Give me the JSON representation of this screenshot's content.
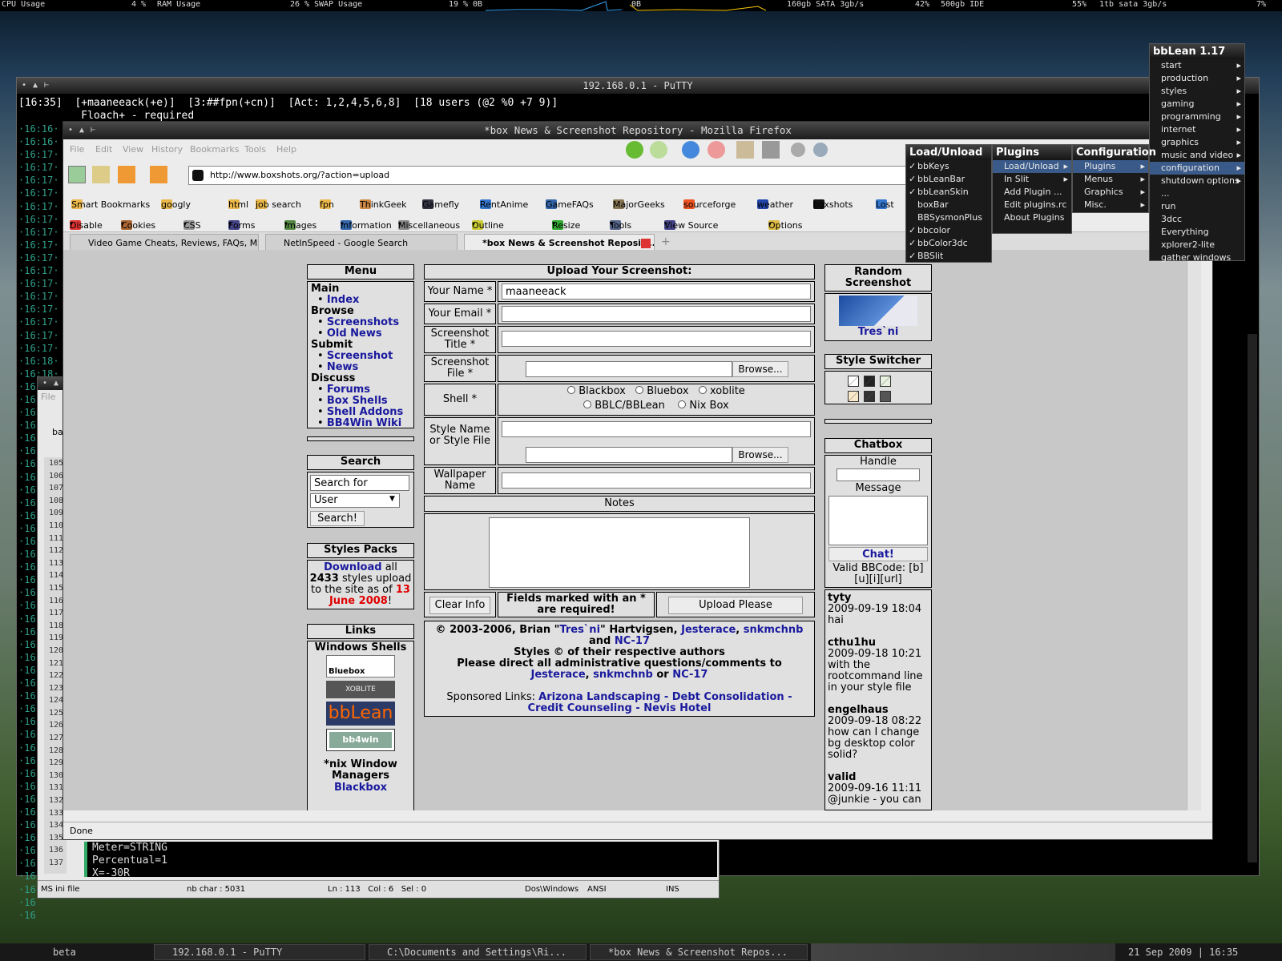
{
  "sysbar": {
    "cpu_label": "CPU Usage",
    "cpu_val": "4 %",
    "ram_label": "RAM Usage",
    "ram_val": "26 %",
    "swap_label": "SWAP Usage",
    "swap_val": "19 %",
    "net1": "0B",
    "net2": "0B",
    "disk1": "160gb SATA 3gb/s",
    "disk1_val": "42%",
    "disk2": "500gb IDE",
    "disk2_val": "55%",
    "disk3": "1tb sata 3gb/s",
    "disk3_val": "7%"
  },
  "putty": {
    "title": "192.168.0.1 - PuTTY",
    "status_time": "16:35",
    "status_nick": "+maaneeack(+e)",
    "status_chan": "3:##fpn(+cn)",
    "status_act": "Act: 1,2,4,5,6,8",
    "status_users": "18 users (@2 %0 +7 9)",
    "line1": "Floach+ - required",
    "times": [
      "·16:16·",
      "·16:16·",
      "·16:17·",
      "·16:17·",
      "·16:17·",
      "·16:17·",
      "·16:17·",
      "·16:17·",
      "·16:17·",
      "·16:17·",
      "·16:17·",
      "·16:17·",
      "·16:17·",
      "·16:17·",
      "·16:17·",
      "·16:17·",
      "·16:17·",
      "·16:17·",
      "·16:18·",
      "·16:18·",
      "·16:18·",
      "·16:18·",
      "·16:18·",
      "·16:16",
      "·16",
      "·16",
      "·16",
      "·16",
      "·16",
      "·16",
      "·16",
      "·16",
      "·16",
      "·16",
      "·16",
      "·16",
      "·16",
      "·16",
      "·16",
      "·16",
      "·16",
      "·16",
      "·16",
      "·16",
      "·16",
      "·16",
      "·16",
      "·16",
      "·16",
      "·16",
      "·16",
      "·16",
      "·16",
      "·16",
      "·16",
      "·16",
      "·16",
      "·16",
      "·16",
      "·16",
      "·16",
      "·16"
    ]
  },
  "editor": {
    "menu_file": "File",
    "tab_label": "ba",
    "lines": [
      "105",
      "106",
      "107",
      "108",
      "109",
      "110",
      "111",
      "112",
      "113",
      "114",
      "115",
      "116",
      "117",
      "118",
      "119",
      "120",
      "121",
      "122",
      "123",
      "124",
      "125",
      "126",
      "127",
      "128",
      "129",
      "130",
      "131",
      "132",
      "133",
      "134",
      "135",
      "136",
      "137"
    ],
    "code": [
      "Meter=STRING",
      "Percentual=1",
      "X=-30R"
    ],
    "status": {
      "type": "MS ini file",
      "chars": "nb char : 5031",
      "pos": "Ln : 113   Col : 6   Sel : 0",
      "eol": "Dos\\Windows",
      "enc": "ANSI",
      "mode": "INS"
    }
  },
  "firefox": {
    "title": "*box News & Screenshot Repository - Mozilla Firefox",
    "menu": [
      "File",
      "Edit",
      "View",
      "History",
      "Bookmarks",
      "Tools",
      "Help"
    ],
    "url": "http://www.boxshots.org/?action=upload",
    "bookmarks": [
      "Smart Bookmarks",
      "googly",
      "html",
      "job search",
      "fpn",
      "ThinkGeek",
      "Gamefly",
      "RentAnime",
      "GameFAQs",
      "MajorGeeks",
      "sourceforge",
      "weather",
      "boxshots",
      "Lost"
    ],
    "webdev": [
      "Disable",
      "Cookies",
      "CSS",
      "Forms",
      "Images",
      "Information",
      "Miscellaneous",
      "Outline",
      "Resize",
      "Tools",
      "View Source",
      "Options"
    ],
    "tabs": [
      "Video Game Cheats, Reviews, FAQs, M...",
      "NetInSpeed - Google Search",
      "*box News & Screenshot Reposit..."
    ],
    "status": "Done"
  },
  "page": {
    "menu": {
      "title": "Menu",
      "main": "Main",
      "index": "Index",
      "browse": "Browse",
      "screenshots": "Screenshots",
      "oldnews": "Old News",
      "submit": "Submit",
      "screenshot": "Screenshot",
      "news": "News",
      "discuss": "Discuss",
      "forums": "Forums",
      "boxshells": "Box Shells",
      "shelladdons": "Shell Addons",
      "wiki": "BB4Win Wiki"
    },
    "search": {
      "title": "Search",
      "placeholder": "Search for",
      "select": "User",
      "button": "Search!"
    },
    "styles": {
      "title": "Styles Packs",
      "download": "Download",
      "t1": " all ",
      "count": "2433",
      "t2": " styles upload to the site as of ",
      "date": "13 June 2008",
      "t3": "!"
    },
    "links": {
      "title": "Links",
      "shells": "Windows Shells",
      "bluebox": "Bluebox",
      "xoblite": "XOBLITE",
      "bblean": "bbLean",
      "bb4win": "bb4win",
      "nix": "*nix Window Managers",
      "blackbox": "Blackbox"
    },
    "upload": {
      "title": "Upload Your Screenshot:",
      "name_label": "Your Name *",
      "name_value": "maaneeack",
      "email_label": "Your Email *",
      "title_label": "Screenshot Title *",
      "file_label": "Screenshot File *",
      "browse": "Browse...",
      "shell_label": "Shell *",
      "shells": [
        "Blackbox",
        "Bluebox",
        "xoblite",
        "BBLC/BBLean",
        "Nix Box"
      ],
      "style_label": "Style Name or Style File",
      "wall_label": "Wallpaper Name",
      "notes": "Notes",
      "clear": "Clear Info",
      "required": "Fields marked with an * are required!",
      "submit": "Upload Please"
    },
    "footer": {
      "copy": "© 2003-2006, Brian \"",
      "tres": "Tres`ni",
      "copy2": "\" Hartvigsen, ",
      "jest": "Jesterace",
      "comma": ", ",
      "snk": "snkmchnb",
      "and": " and ",
      "nc": "NC-17",
      "styles": "Styles © of their respective authors",
      "direct": "Please direct all administrative questions/comments to ",
      "or": " or ",
      "sponsored": "Sponsored Links: ",
      "l1": "Arizona Landscaping",
      "dash": " - ",
      "l2": "Debt Consolidation",
      "l3": "Credit Counseling",
      "l4": "Nevis Hotel"
    },
    "random": {
      "title": "Random Screenshot",
      "author": "Tres`ni"
    },
    "switcher": {
      "title": "Style Switcher"
    },
    "chatbox": {
      "title": "Chatbox",
      "handle": "Handle",
      "message": "Message",
      "button": "Chat!",
      "bbcode": "Valid BBCode: [b][u][i][url]",
      "posts": [
        {
          "user": "tyty",
          "time": "2009-09-19 18:04",
          "msg": "hai"
        },
        {
          "user": "cthu1hu",
          "time": "2009-09-18 10:21",
          "msg": "with the rootcommand line in your style file"
        },
        {
          "user": "engelhaus",
          "time": "2009-09-18 08:22",
          "msg": "how can I change bg desktop color solid?"
        },
        {
          "user": "valid",
          "time": "2009-09-16 11:11",
          "msg": "@junkie - you can"
        }
      ]
    }
  },
  "bblean": {
    "title": "bbLean 1.17",
    "root": [
      "start",
      "production",
      "styles",
      "gaming",
      "programming",
      "internet",
      "graphics",
      "music and video",
      "configuration",
      "shutdown options",
      "...",
      "run",
      "3dcc",
      "Everything",
      "xplorer2-lite",
      "gather windows"
    ],
    "config": {
      "title": "Configuration",
      "items": [
        "Plugins",
        "Menus",
        "Graphics",
        "Misc."
      ]
    },
    "plugins": {
      "title": "Plugins",
      "items": [
        "Load/Unload",
        "In Slit",
        "Add Plugin ...",
        "Edit plugins.rc",
        "About Plugins"
      ]
    },
    "loadunload": {
      "title": "Load/Unload",
      "items": [
        {
          "n": "bbKeys",
          "c": true
        },
        {
          "n": "bbLeanBar",
          "c": true
        },
        {
          "n": "bbLeanSkin",
          "c": true
        },
        {
          "n": "boxBar",
          "c": false
        },
        {
          "n": "BBSysmonPlus",
          "c": false
        },
        {
          "n": "bbcolor",
          "c": true
        },
        {
          "n": "bbColor3dc",
          "c": true
        },
        {
          "n": "BBSlit",
          "c": true
        }
      ]
    }
  },
  "taskbar": {
    "label": "beta",
    "t1": "192.168.0.1 - PuTTY",
    "t2": "C:\\Documents and Settings\\Ri...",
    "t3": "*box News & Screenshot Repos...",
    "clock": "21 Sep 2009 | 16:35"
  }
}
